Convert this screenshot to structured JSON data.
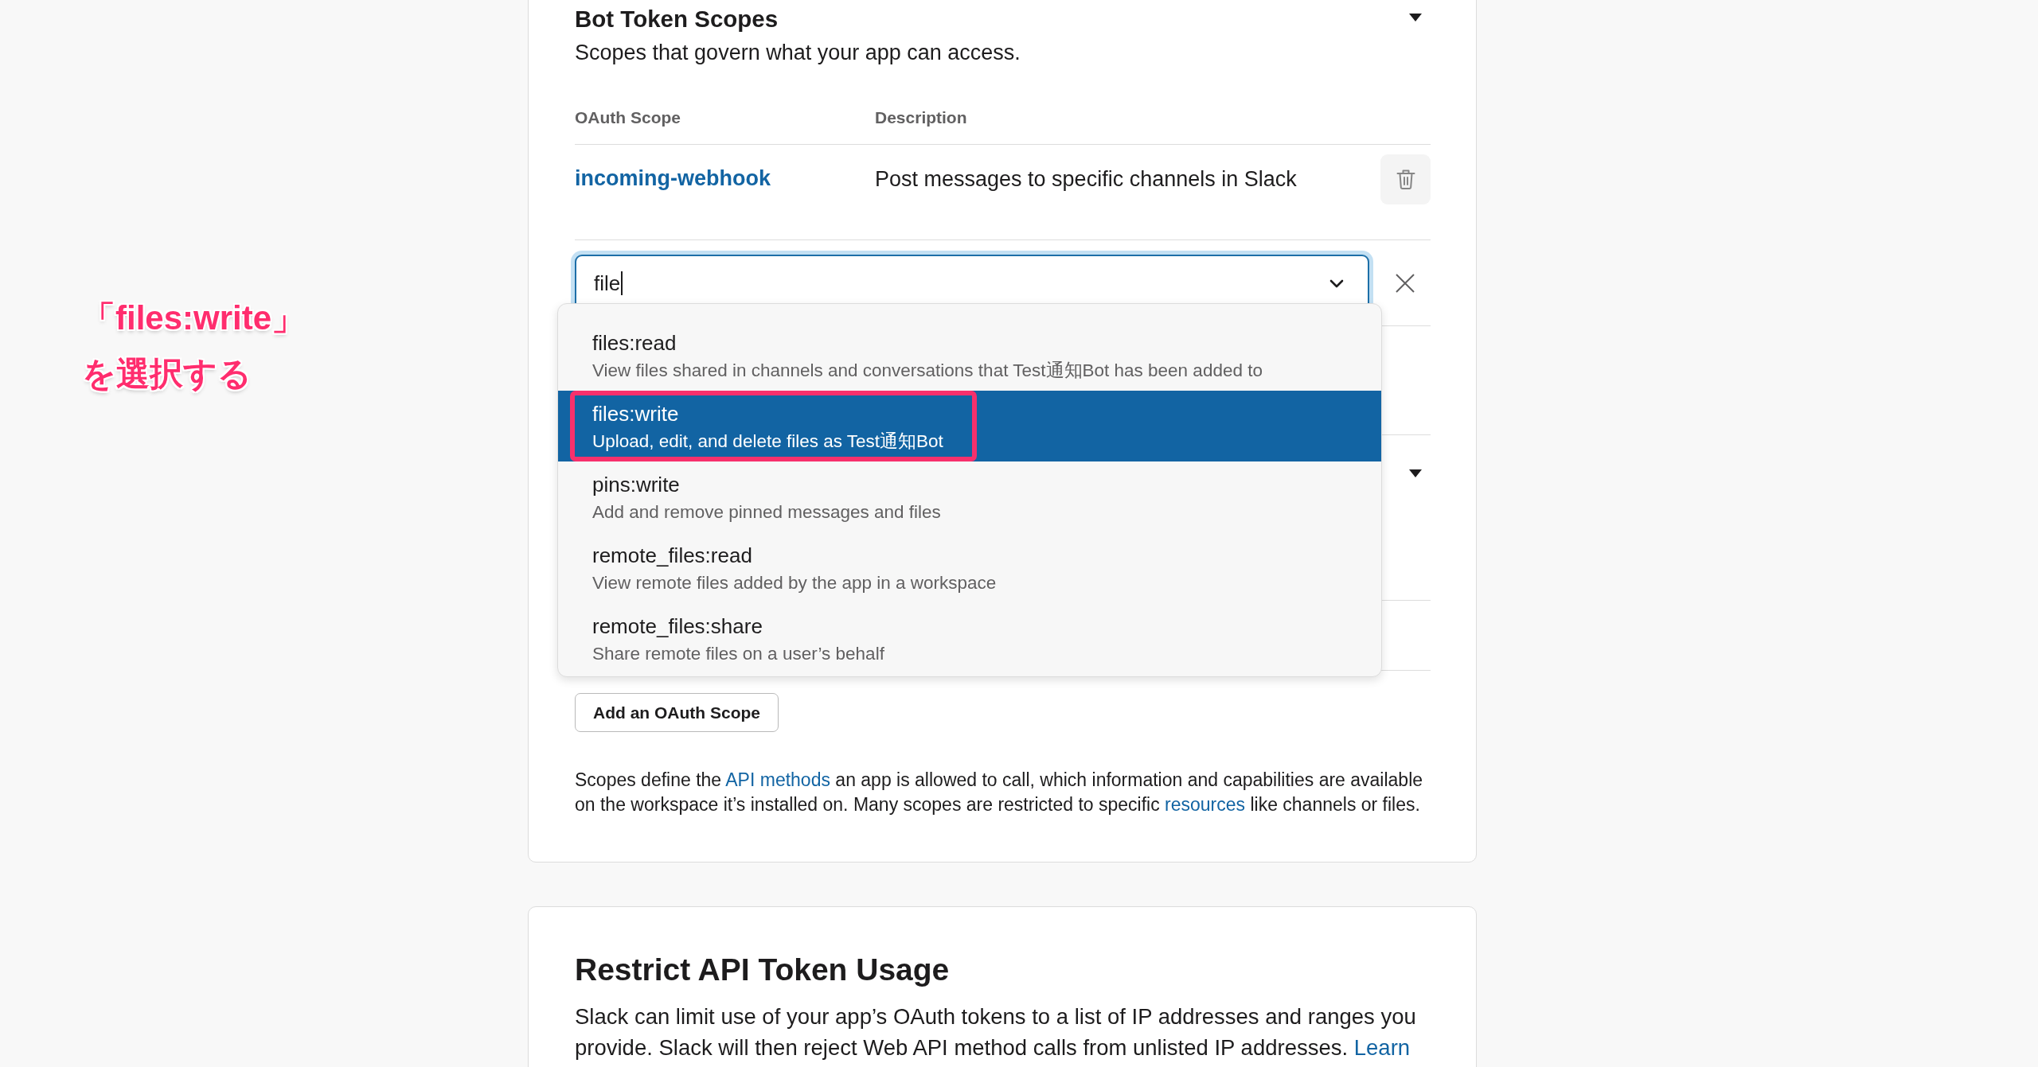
{
  "annotation": {
    "lines": [
      "「files:write」",
      "を選択する"
    ]
  },
  "bot_token_scopes": {
    "title": "Bot Token Scopes",
    "expanded": true,
    "subtitle": "Scopes that govern what your app can access.",
    "columns": [
      "OAuth Scope",
      "Description"
    ],
    "rows": [
      {
        "scope": "incoming-webhook",
        "description": "Post messages to specific channels in Slack"
      }
    ],
    "scope_search": {
      "value": "file",
      "options": [
        {
          "name": "files:read",
          "description": "View files shared in channels and conversations that Test通知Bot has been added to",
          "selected": false,
          "highlighted": false
        },
        {
          "name": "files:write",
          "description": "Upload, edit, and delete files as Test通知Bot",
          "selected": true,
          "highlighted": true
        },
        {
          "name": "pins:write",
          "description": "Add and remove pinned messages and files",
          "selected": false,
          "highlighted": false
        },
        {
          "name": "remote_files:read",
          "description": "View remote files added by the app in a workspace",
          "selected": false,
          "highlighted": false
        },
        {
          "name": "remote_files:share",
          "description": "Share remote files on a user’s behalf",
          "selected": false,
          "highlighted": false
        }
      ]
    },
    "add_button": "Add an OAuth Scope",
    "note": [
      {
        "kind": "text",
        "text": "Scopes define the "
      },
      {
        "kind": "link",
        "text": "API methods"
      },
      {
        "kind": "text",
        "text": " an app is allowed to call, which information and capabilities are available on the workspace it’s installed on. Many scopes are restricted to specific "
      },
      {
        "kind": "link",
        "text": "resources"
      },
      {
        "kind": "text",
        "text": " like channels or files."
      }
    ]
  },
  "restrict_api_token_usage": {
    "title": "Restrict API Token Usage",
    "text": [
      {
        "kind": "text",
        "text": "Slack can limit use of your app’s OAuth tokens to a list of IP addresses and ranges you provide. Slack will then reject Web API method calls from unlisted IP addresses. "
      },
      {
        "kind": "link",
        "text": "Learn"
      }
    ]
  }
}
